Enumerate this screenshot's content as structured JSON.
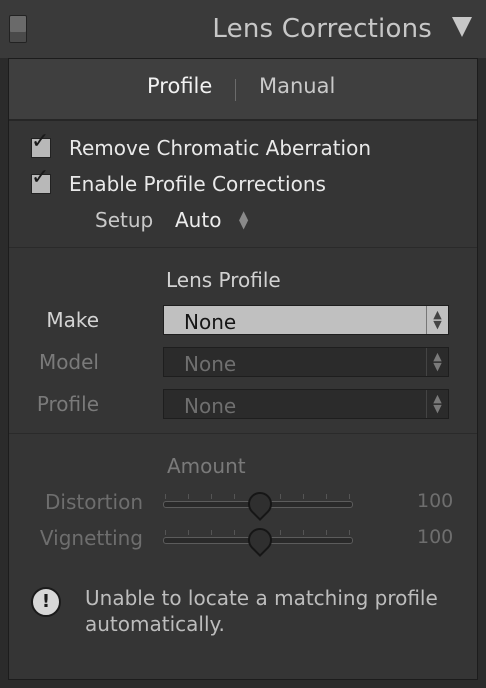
{
  "header": {
    "title": "Lens Corrections"
  },
  "tabs": [
    {
      "label": "Profile"
    },
    {
      "label": "Manual"
    }
  ],
  "options": {
    "remove_ca": {
      "label": "Remove Chromatic Aberration",
      "checked": true
    },
    "enable_profile": {
      "label": "Enable Profile Corrections",
      "checked": true
    },
    "setup": {
      "label": "Setup",
      "value": "Auto"
    }
  },
  "lens_profile": {
    "title": "Lens Profile",
    "make": {
      "label": "Make",
      "value": "None"
    },
    "model": {
      "label": "Model",
      "value": "None"
    },
    "profile": {
      "label": "Profile",
      "value": "None"
    }
  },
  "amount": {
    "title": "Amount",
    "distortion": {
      "label": "Distortion",
      "value": "100"
    },
    "vignetting": {
      "label": "Vignetting",
      "value": "100"
    }
  },
  "warning": {
    "text": "Unable to locate a matching profile automatically."
  },
  "icons": {
    "panel_toggle": "panel-toggle-icon",
    "collapse": "collapse-triangle-icon",
    "checkmark": "checkmark-icon",
    "updown": "up-down-arrows-icon",
    "warning": "warning-icon"
  },
  "colors": {
    "panel_bg": "#3d3d3d",
    "content_bg": "#353535",
    "select_active": "#c0c0c0"
  }
}
